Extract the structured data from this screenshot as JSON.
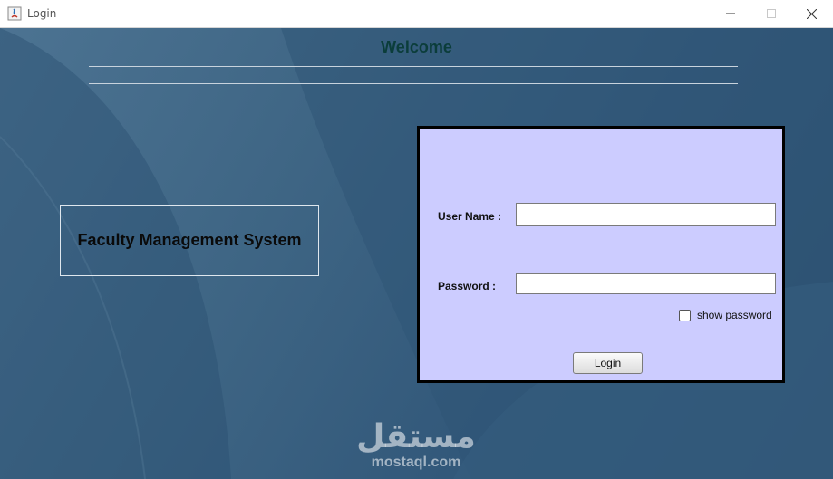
{
  "window": {
    "title": "Login"
  },
  "header": {
    "welcome": "Welcome"
  },
  "brand": {
    "text": "Faculty Management System"
  },
  "login_form": {
    "username_label": "User Name :",
    "username_value": "",
    "password_label": "Password  :",
    "password_value": "",
    "show_password_label": "show password",
    "show_password_checked": false,
    "login_button": "Login"
  },
  "watermark": {
    "arabic": "مستقل",
    "latin": "mostaql.com"
  },
  "colors": {
    "background": "#3e6584",
    "panel": "#ccccff",
    "welcome_text": "#0b3d3a"
  }
}
